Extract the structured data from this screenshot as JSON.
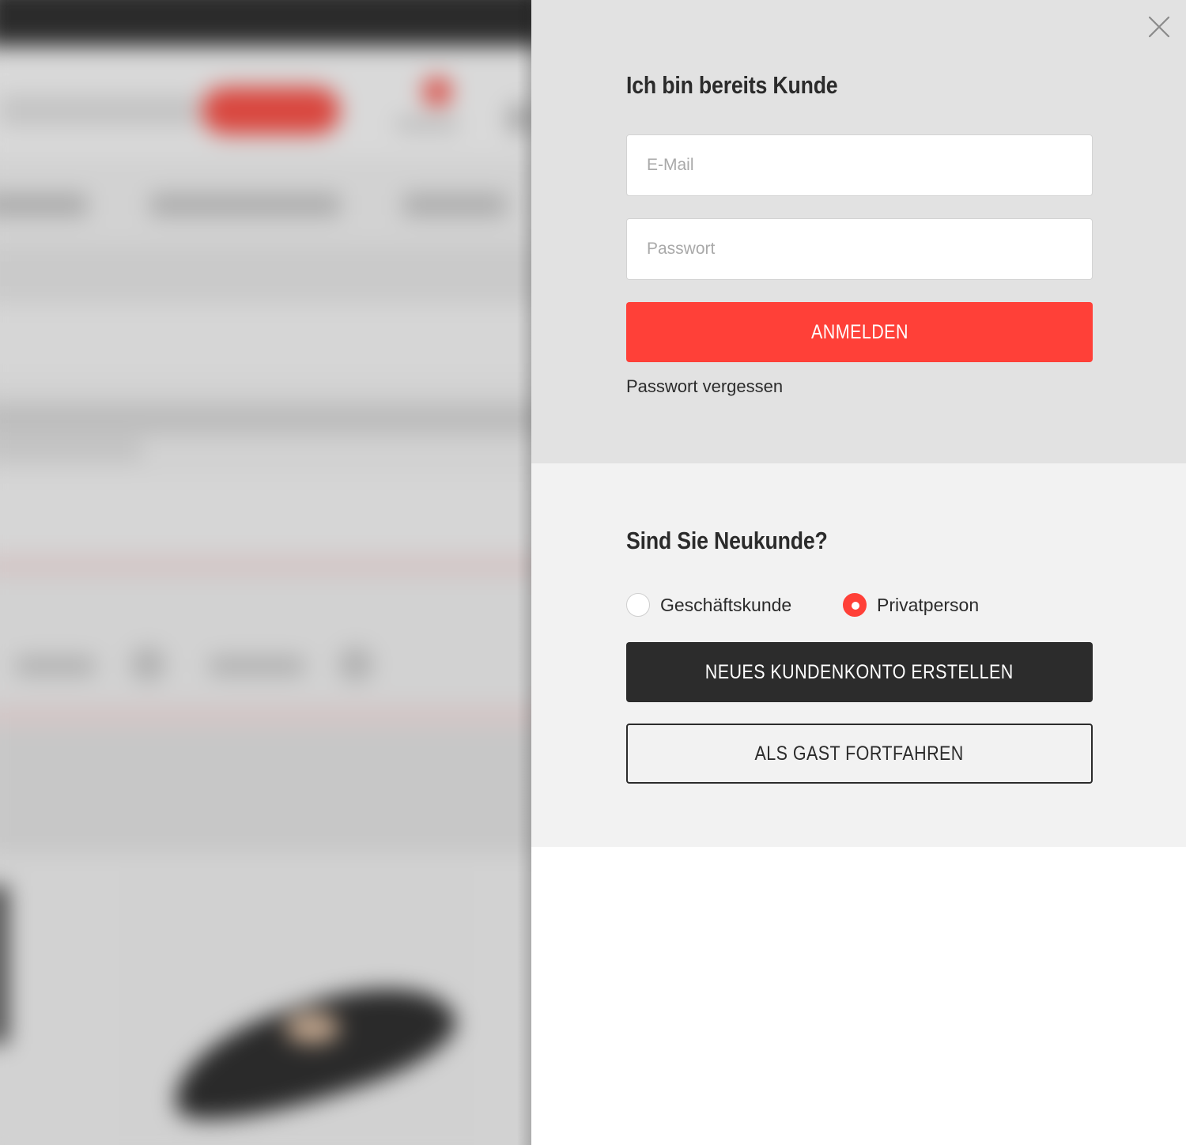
{
  "colors": {
    "accent": "#ff4038",
    "dark_button": "#2c2c2c",
    "login_section_bg": "#e2e2e2",
    "new_customer_section_bg": "#f2f2f2"
  },
  "close": {
    "icon": "close-icon"
  },
  "login": {
    "heading": "Ich bin bereits Kunde",
    "email_placeholder": "E-Mail",
    "email_value": "",
    "password_placeholder": "Passwort",
    "password_value": "",
    "submit_label": "ANMELDEN",
    "forgot_password_label": "Passwort vergessen"
  },
  "new_customer": {
    "heading": "Sind Sie Neukunde?",
    "customer_types": [
      {
        "label": "Geschäftskunde",
        "checked": false
      },
      {
        "label": "Privatperson",
        "checked": true
      }
    ],
    "create_account_label": "NEUES KUNDENKONTO ERSTELLEN",
    "guest_label": "ALS GAST FORTFAHREN"
  }
}
